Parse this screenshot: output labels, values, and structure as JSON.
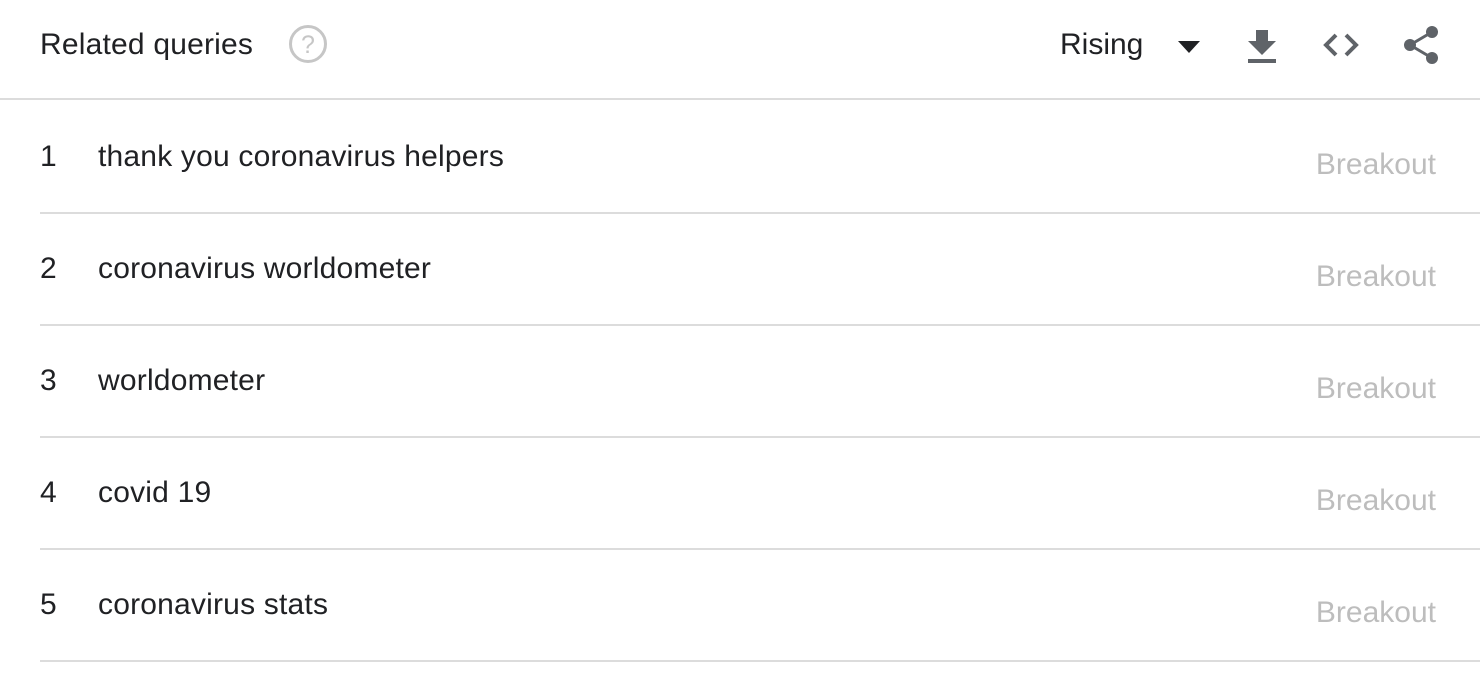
{
  "header": {
    "title": "Related queries",
    "help_icon": "help-circle-icon",
    "sort_selected": "Rising",
    "dropdown_icon": "arrow-drop-down-icon",
    "actions": [
      {
        "icon": "download-icon"
      },
      {
        "icon": "embed-code-icon"
      },
      {
        "icon": "share-icon"
      }
    ]
  },
  "colors": {
    "text": "#202124",
    "muted": "#bdbdbd",
    "icon": "#5f6368",
    "help": "#c6c6c6",
    "divider": "#dcdcdc"
  },
  "queries": [
    {
      "rank": "1",
      "query": "thank you coronavirus helpers",
      "value": "Breakout"
    },
    {
      "rank": "2",
      "query": "coronavirus worldometer",
      "value": "Breakout"
    },
    {
      "rank": "3",
      "query": "worldometer",
      "value": "Breakout"
    },
    {
      "rank": "4",
      "query": "covid 19",
      "value": "Breakout"
    },
    {
      "rank": "5",
      "query": "coronavirus stats",
      "value": "Breakout"
    }
  ]
}
